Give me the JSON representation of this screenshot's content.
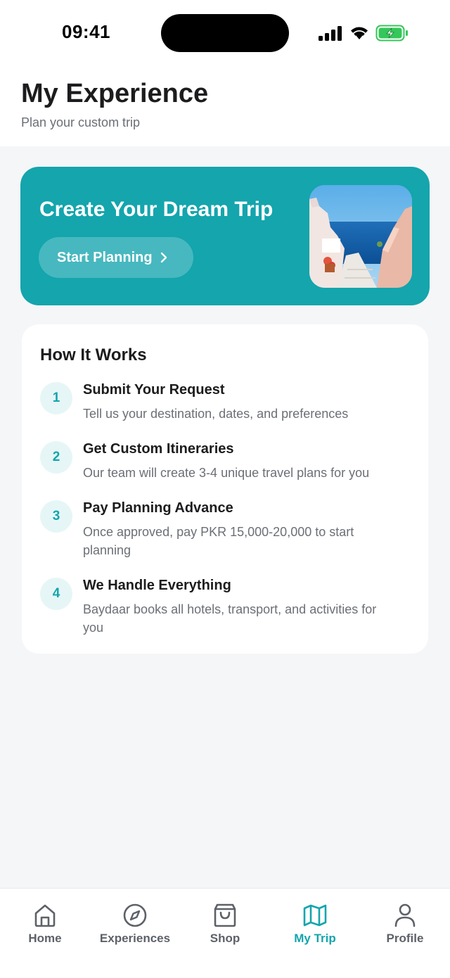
{
  "status_bar": {
    "time": "09:41"
  },
  "header": {
    "title": "My Experience",
    "subtitle": "Plan your custom trip"
  },
  "hero": {
    "title": "Create Your Dream Trip",
    "button_label": "Start Planning",
    "image_icon": "coastal-village-photo"
  },
  "how_it_works": {
    "title": "How It Works",
    "steps": [
      {
        "number": "1",
        "title": "Submit Your Request",
        "description": "Tell us your destination, dates, and preferences"
      },
      {
        "number": "2",
        "title": "Get Custom Itineraries",
        "description": "Our team will create 3-4 unique travel plans for you"
      },
      {
        "number": "3",
        "title": "Pay Planning Advance",
        "description": "Once approved, pay PKR 15,000-20,000 to start planning"
      },
      {
        "number": "4",
        "title": "We Handle Everything",
        "description": "Baydaar books all hotels, transport, and activities for you"
      }
    ]
  },
  "bottom_nav": {
    "items": [
      {
        "label": "Home",
        "icon": "home-icon"
      },
      {
        "label": "Experiences",
        "icon": "compass-icon"
      },
      {
        "label": "Shop",
        "icon": "shopping-bag-icon"
      },
      {
        "label": "My Trip",
        "icon": "map-icon",
        "active": true
      },
      {
        "label": "Profile",
        "icon": "user-icon"
      }
    ]
  },
  "colors": {
    "accent": "#14a5ad",
    "background": "#f5f6f8",
    "text_muted": "#6b6f76"
  }
}
